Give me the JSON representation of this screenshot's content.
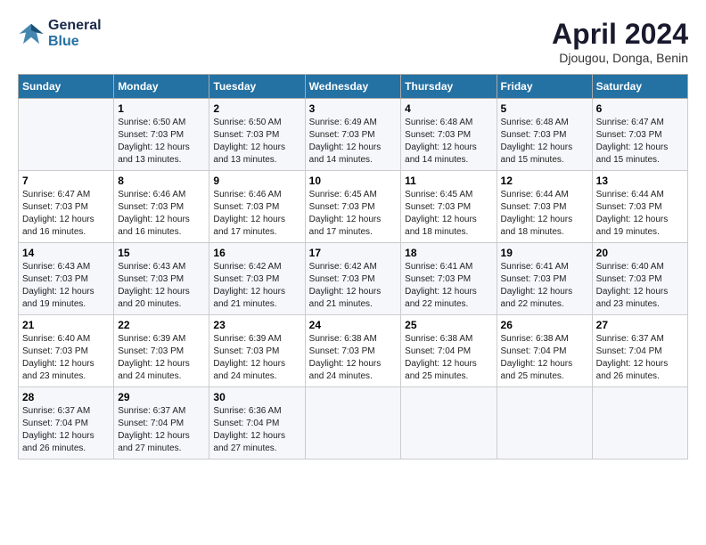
{
  "header": {
    "logo_line1": "General",
    "logo_line2": "Blue",
    "month": "April 2024",
    "location": "Djougou, Donga, Benin"
  },
  "weekdays": [
    "Sunday",
    "Monday",
    "Tuesday",
    "Wednesday",
    "Thursday",
    "Friday",
    "Saturday"
  ],
  "weeks": [
    [
      {
        "day": "",
        "info": ""
      },
      {
        "day": "1",
        "info": "Sunrise: 6:50 AM\nSunset: 7:03 PM\nDaylight: 12 hours\nand 13 minutes."
      },
      {
        "day": "2",
        "info": "Sunrise: 6:50 AM\nSunset: 7:03 PM\nDaylight: 12 hours\nand 13 minutes."
      },
      {
        "day": "3",
        "info": "Sunrise: 6:49 AM\nSunset: 7:03 PM\nDaylight: 12 hours\nand 14 minutes."
      },
      {
        "day": "4",
        "info": "Sunrise: 6:48 AM\nSunset: 7:03 PM\nDaylight: 12 hours\nand 14 minutes."
      },
      {
        "day": "5",
        "info": "Sunrise: 6:48 AM\nSunset: 7:03 PM\nDaylight: 12 hours\nand 15 minutes."
      },
      {
        "day": "6",
        "info": "Sunrise: 6:47 AM\nSunset: 7:03 PM\nDaylight: 12 hours\nand 15 minutes."
      }
    ],
    [
      {
        "day": "7",
        "info": "Sunrise: 6:47 AM\nSunset: 7:03 PM\nDaylight: 12 hours\nand 16 minutes."
      },
      {
        "day": "8",
        "info": "Sunrise: 6:46 AM\nSunset: 7:03 PM\nDaylight: 12 hours\nand 16 minutes."
      },
      {
        "day": "9",
        "info": "Sunrise: 6:46 AM\nSunset: 7:03 PM\nDaylight: 12 hours\nand 17 minutes."
      },
      {
        "day": "10",
        "info": "Sunrise: 6:45 AM\nSunset: 7:03 PM\nDaylight: 12 hours\nand 17 minutes."
      },
      {
        "day": "11",
        "info": "Sunrise: 6:45 AM\nSunset: 7:03 PM\nDaylight: 12 hours\nand 18 minutes."
      },
      {
        "day": "12",
        "info": "Sunrise: 6:44 AM\nSunset: 7:03 PM\nDaylight: 12 hours\nand 18 minutes."
      },
      {
        "day": "13",
        "info": "Sunrise: 6:44 AM\nSunset: 7:03 PM\nDaylight: 12 hours\nand 19 minutes."
      }
    ],
    [
      {
        "day": "14",
        "info": "Sunrise: 6:43 AM\nSunset: 7:03 PM\nDaylight: 12 hours\nand 19 minutes."
      },
      {
        "day": "15",
        "info": "Sunrise: 6:43 AM\nSunset: 7:03 PM\nDaylight: 12 hours\nand 20 minutes."
      },
      {
        "day": "16",
        "info": "Sunrise: 6:42 AM\nSunset: 7:03 PM\nDaylight: 12 hours\nand 21 minutes."
      },
      {
        "day": "17",
        "info": "Sunrise: 6:42 AM\nSunset: 7:03 PM\nDaylight: 12 hours\nand 21 minutes."
      },
      {
        "day": "18",
        "info": "Sunrise: 6:41 AM\nSunset: 7:03 PM\nDaylight: 12 hours\nand 22 minutes."
      },
      {
        "day": "19",
        "info": "Sunrise: 6:41 AM\nSunset: 7:03 PM\nDaylight: 12 hours\nand 22 minutes."
      },
      {
        "day": "20",
        "info": "Sunrise: 6:40 AM\nSunset: 7:03 PM\nDaylight: 12 hours\nand 23 minutes."
      }
    ],
    [
      {
        "day": "21",
        "info": "Sunrise: 6:40 AM\nSunset: 7:03 PM\nDaylight: 12 hours\nand 23 minutes."
      },
      {
        "day": "22",
        "info": "Sunrise: 6:39 AM\nSunset: 7:03 PM\nDaylight: 12 hours\nand 24 minutes."
      },
      {
        "day": "23",
        "info": "Sunrise: 6:39 AM\nSunset: 7:03 PM\nDaylight: 12 hours\nand 24 minutes."
      },
      {
        "day": "24",
        "info": "Sunrise: 6:38 AM\nSunset: 7:03 PM\nDaylight: 12 hours\nand 24 minutes."
      },
      {
        "day": "25",
        "info": "Sunrise: 6:38 AM\nSunset: 7:04 PM\nDaylight: 12 hours\nand 25 minutes."
      },
      {
        "day": "26",
        "info": "Sunrise: 6:38 AM\nSunset: 7:04 PM\nDaylight: 12 hours\nand 25 minutes."
      },
      {
        "day": "27",
        "info": "Sunrise: 6:37 AM\nSunset: 7:04 PM\nDaylight: 12 hours\nand 26 minutes."
      }
    ],
    [
      {
        "day": "28",
        "info": "Sunrise: 6:37 AM\nSunset: 7:04 PM\nDaylight: 12 hours\nand 26 minutes."
      },
      {
        "day": "29",
        "info": "Sunrise: 6:37 AM\nSunset: 7:04 PM\nDaylight: 12 hours\nand 27 minutes."
      },
      {
        "day": "30",
        "info": "Sunrise: 6:36 AM\nSunset: 7:04 PM\nDaylight: 12 hours\nand 27 minutes."
      },
      {
        "day": "",
        "info": ""
      },
      {
        "day": "",
        "info": ""
      },
      {
        "day": "",
        "info": ""
      },
      {
        "day": "",
        "info": ""
      }
    ]
  ]
}
